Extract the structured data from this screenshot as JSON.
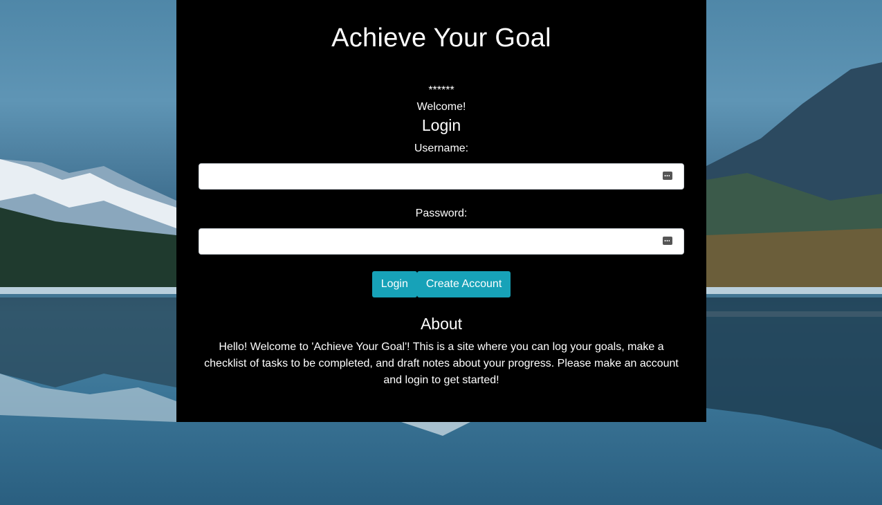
{
  "header": {
    "title": "Achieve Your Goal"
  },
  "status": {
    "stars": "******",
    "welcome": "Welcome!"
  },
  "login": {
    "heading": "Login",
    "username_label": "Username:",
    "username_value": "",
    "password_label": "Password:",
    "password_value": "",
    "login_button": "Login",
    "create_account_button": "Create Account",
    "field_icon": "password-manager-icon"
  },
  "about": {
    "heading": "About",
    "text": "Hello! Welcome to 'Achieve Your Goal'! This is a site where you can log your goals, make a checklist of tasks to be completed, and draft notes about your progress. Please make an account and login to get started!"
  },
  "colors": {
    "panel_background": "#000000",
    "button_background": "#17a2b8",
    "text": "#ffffff"
  }
}
